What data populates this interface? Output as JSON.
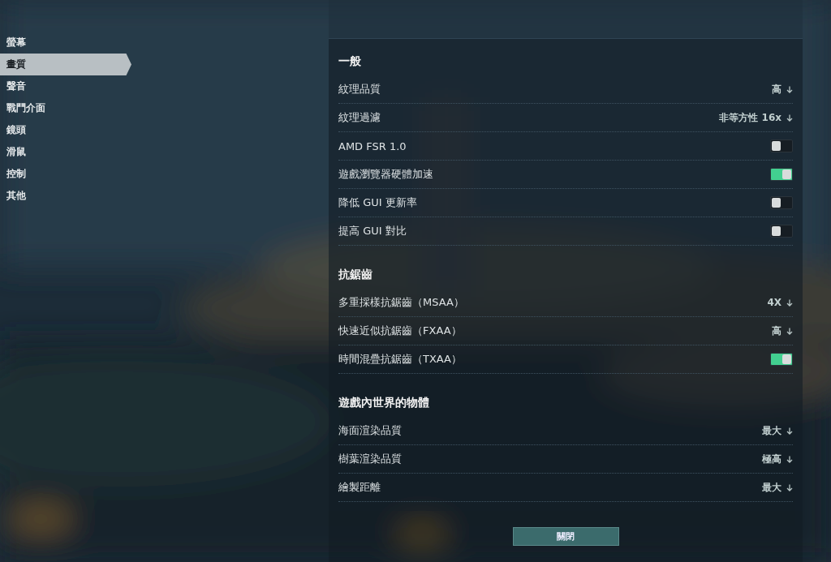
{
  "sidebar": {
    "items": [
      {
        "label": "螢幕",
        "selected": false
      },
      {
        "label": "畫質",
        "selected": true
      },
      {
        "label": "聲音",
        "selected": false
      },
      {
        "label": "戰鬥介面",
        "selected": false
      },
      {
        "label": "鏡頭",
        "selected": false
      },
      {
        "label": "滑鼠",
        "selected": false
      },
      {
        "label": "控制",
        "selected": false
      },
      {
        "label": "其他",
        "selected": false
      }
    ]
  },
  "sections": [
    {
      "heading": "一般",
      "rows": [
        {
          "kind": "dropdown",
          "label": "紋理品質",
          "value": "高"
        },
        {
          "kind": "dropdown",
          "label": "紋理過濾",
          "value": "非等方性 16x"
        },
        {
          "kind": "toggle",
          "label": "AMD FSR 1.0",
          "on": false
        },
        {
          "kind": "toggle",
          "label": "遊戲瀏覽器硬體加速",
          "on": true
        },
        {
          "kind": "toggle",
          "label": "降低 GUI 更新率",
          "on": false
        },
        {
          "kind": "toggle",
          "label": "提高 GUI 對比",
          "on": false
        }
      ]
    },
    {
      "heading": "抗鋸齒",
      "rows": [
        {
          "kind": "dropdown",
          "label": "多重採樣抗鋸齒（MSAA）",
          "value": "4X"
        },
        {
          "kind": "dropdown",
          "label": "快速近似抗鋸齒（FXAA）",
          "value": "高"
        },
        {
          "kind": "toggle",
          "label": "時間混疊抗鋸齒（TXAA）",
          "on": true
        }
      ]
    },
    {
      "heading": "遊戲內世界的物體",
      "rows": [
        {
          "kind": "dropdown",
          "label": "海面渲染品質",
          "value": "最大"
        },
        {
          "kind": "dropdown",
          "label": "樹葉渲染品質",
          "value": "極高"
        },
        {
          "kind": "dropdown",
          "label": "繪製距離",
          "value": "最大"
        }
      ]
    }
  ],
  "close_button": "關閉"
}
